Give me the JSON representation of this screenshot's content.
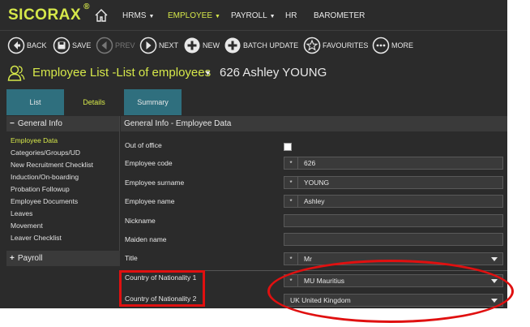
{
  "app": {
    "logo": "SICORAX",
    "logo_mark": "®"
  },
  "nav": {
    "hrms": "HRMS",
    "employee": "EMPLOYEE",
    "payroll": "PAYROLL",
    "hr": "HR",
    "barometer": "BAROMETER"
  },
  "toolbar": {
    "back": "BACK",
    "save": "SAVE",
    "prev": "PREV",
    "next": "NEXT",
    "new": "NEW",
    "batch_update": "BATCH UPDATE",
    "favourites": "FAVOURITES",
    "more": "MORE"
  },
  "header": {
    "title": "Employee List -List of employees",
    "employee": "626 Ashley YOUNG"
  },
  "tabs": {
    "list": "List",
    "details": "Details",
    "summary": "Summary"
  },
  "sidebar": {
    "general_info": "General Info",
    "items": [
      "Employee Data",
      "Categories/Groups/UD",
      "New Recruitment Checklist",
      "Induction/On-boarding",
      "Probation Followup",
      "Employee Documents",
      "Leaves",
      "Movement",
      "Leaver Checklist"
    ],
    "payroll": "Payroll"
  },
  "form": {
    "section_title": "General Info - Employee Data",
    "labels": {
      "out_of_office": "Out of office",
      "code": "Employee code",
      "surname": "Employee surname",
      "name": "Employee name",
      "nickname": "Nickname",
      "maiden": "Maiden name",
      "title": "Title",
      "nationality1": "Country of Nationality 1",
      "nationality2": "Country of Nationality 2"
    },
    "values": {
      "code": "626",
      "surname": "YOUNG",
      "name": "Ashley",
      "nickname": "",
      "maiden": "",
      "title": "Mr",
      "nationality1": "MU Mauritius",
      "nationality2": "UK United Kingdom"
    },
    "required_mark": "*"
  },
  "colors": {
    "accent": "#d6e84a",
    "background": "#2b2b2b",
    "tab": "#2f6f7e",
    "annotation": "#e01010"
  }
}
